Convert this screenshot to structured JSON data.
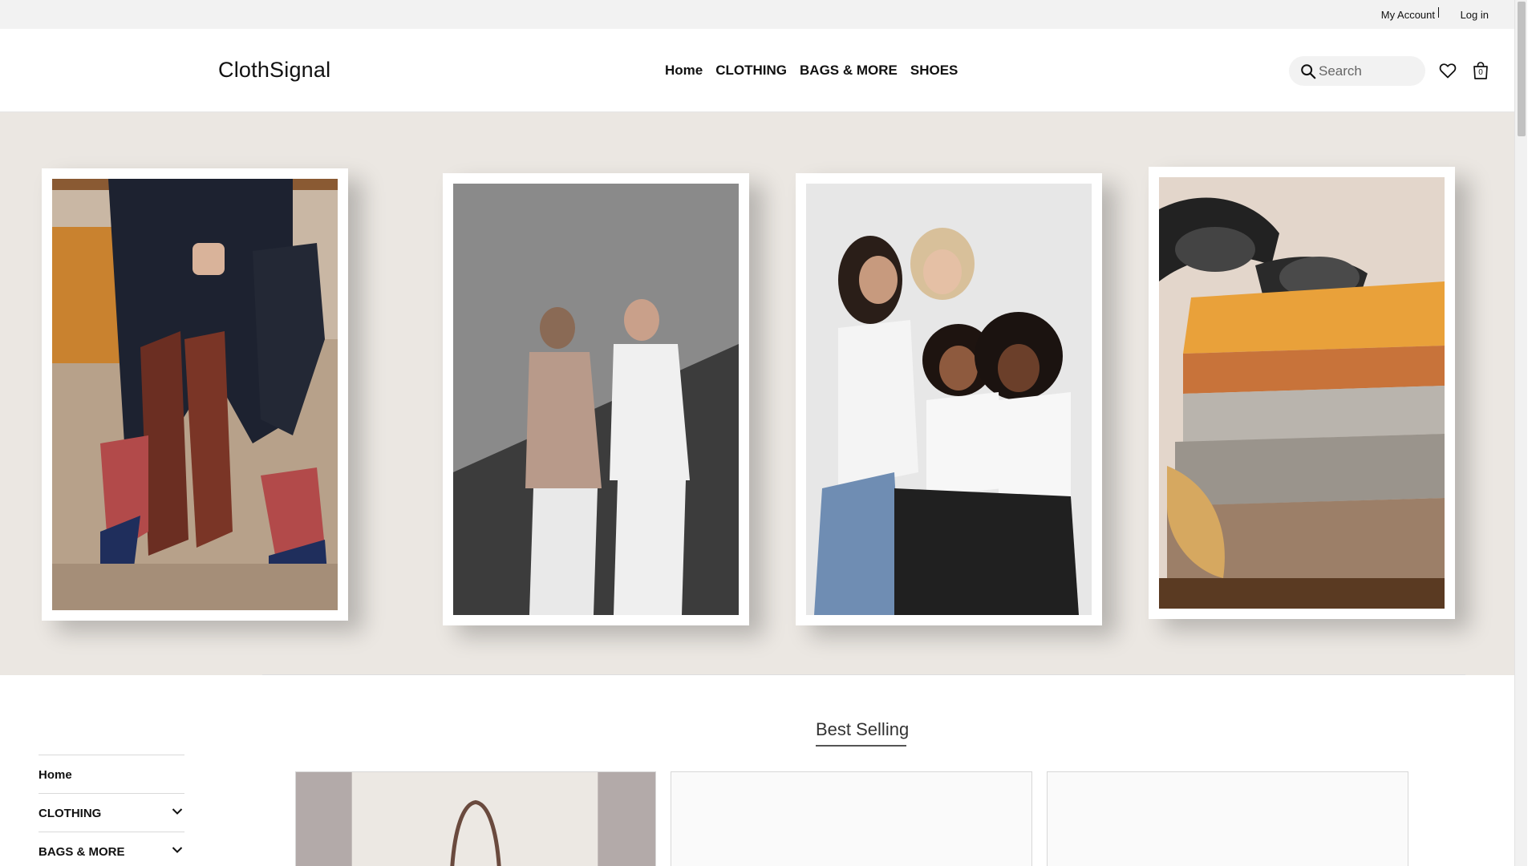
{
  "topbar": {
    "my_account": "My Account",
    "login": "Log in"
  },
  "header": {
    "logo": "ClothSignal",
    "nav": [
      "Home",
      "CLOTHING",
      "BAGS & MORE",
      "SHOES"
    ],
    "search_placeholder": "Search",
    "cart_count": "0"
  },
  "hero": {
    "images": [
      "shoes-photo",
      "two-models-photo",
      "four-women-photo",
      "sweaters-sunglasses-photo"
    ]
  },
  "section": {
    "title": "Best Selling"
  },
  "side_menu": {
    "items": [
      {
        "label": "Home",
        "expandable": false
      },
      {
        "label": "CLOTHING",
        "expandable": true
      },
      {
        "label": "BAGS & MORE",
        "expandable": true
      }
    ]
  },
  "colors": {
    "hero_bg": "#ebe7e2",
    "topbar_bg": "#f2f2f2",
    "text": "#111111"
  }
}
